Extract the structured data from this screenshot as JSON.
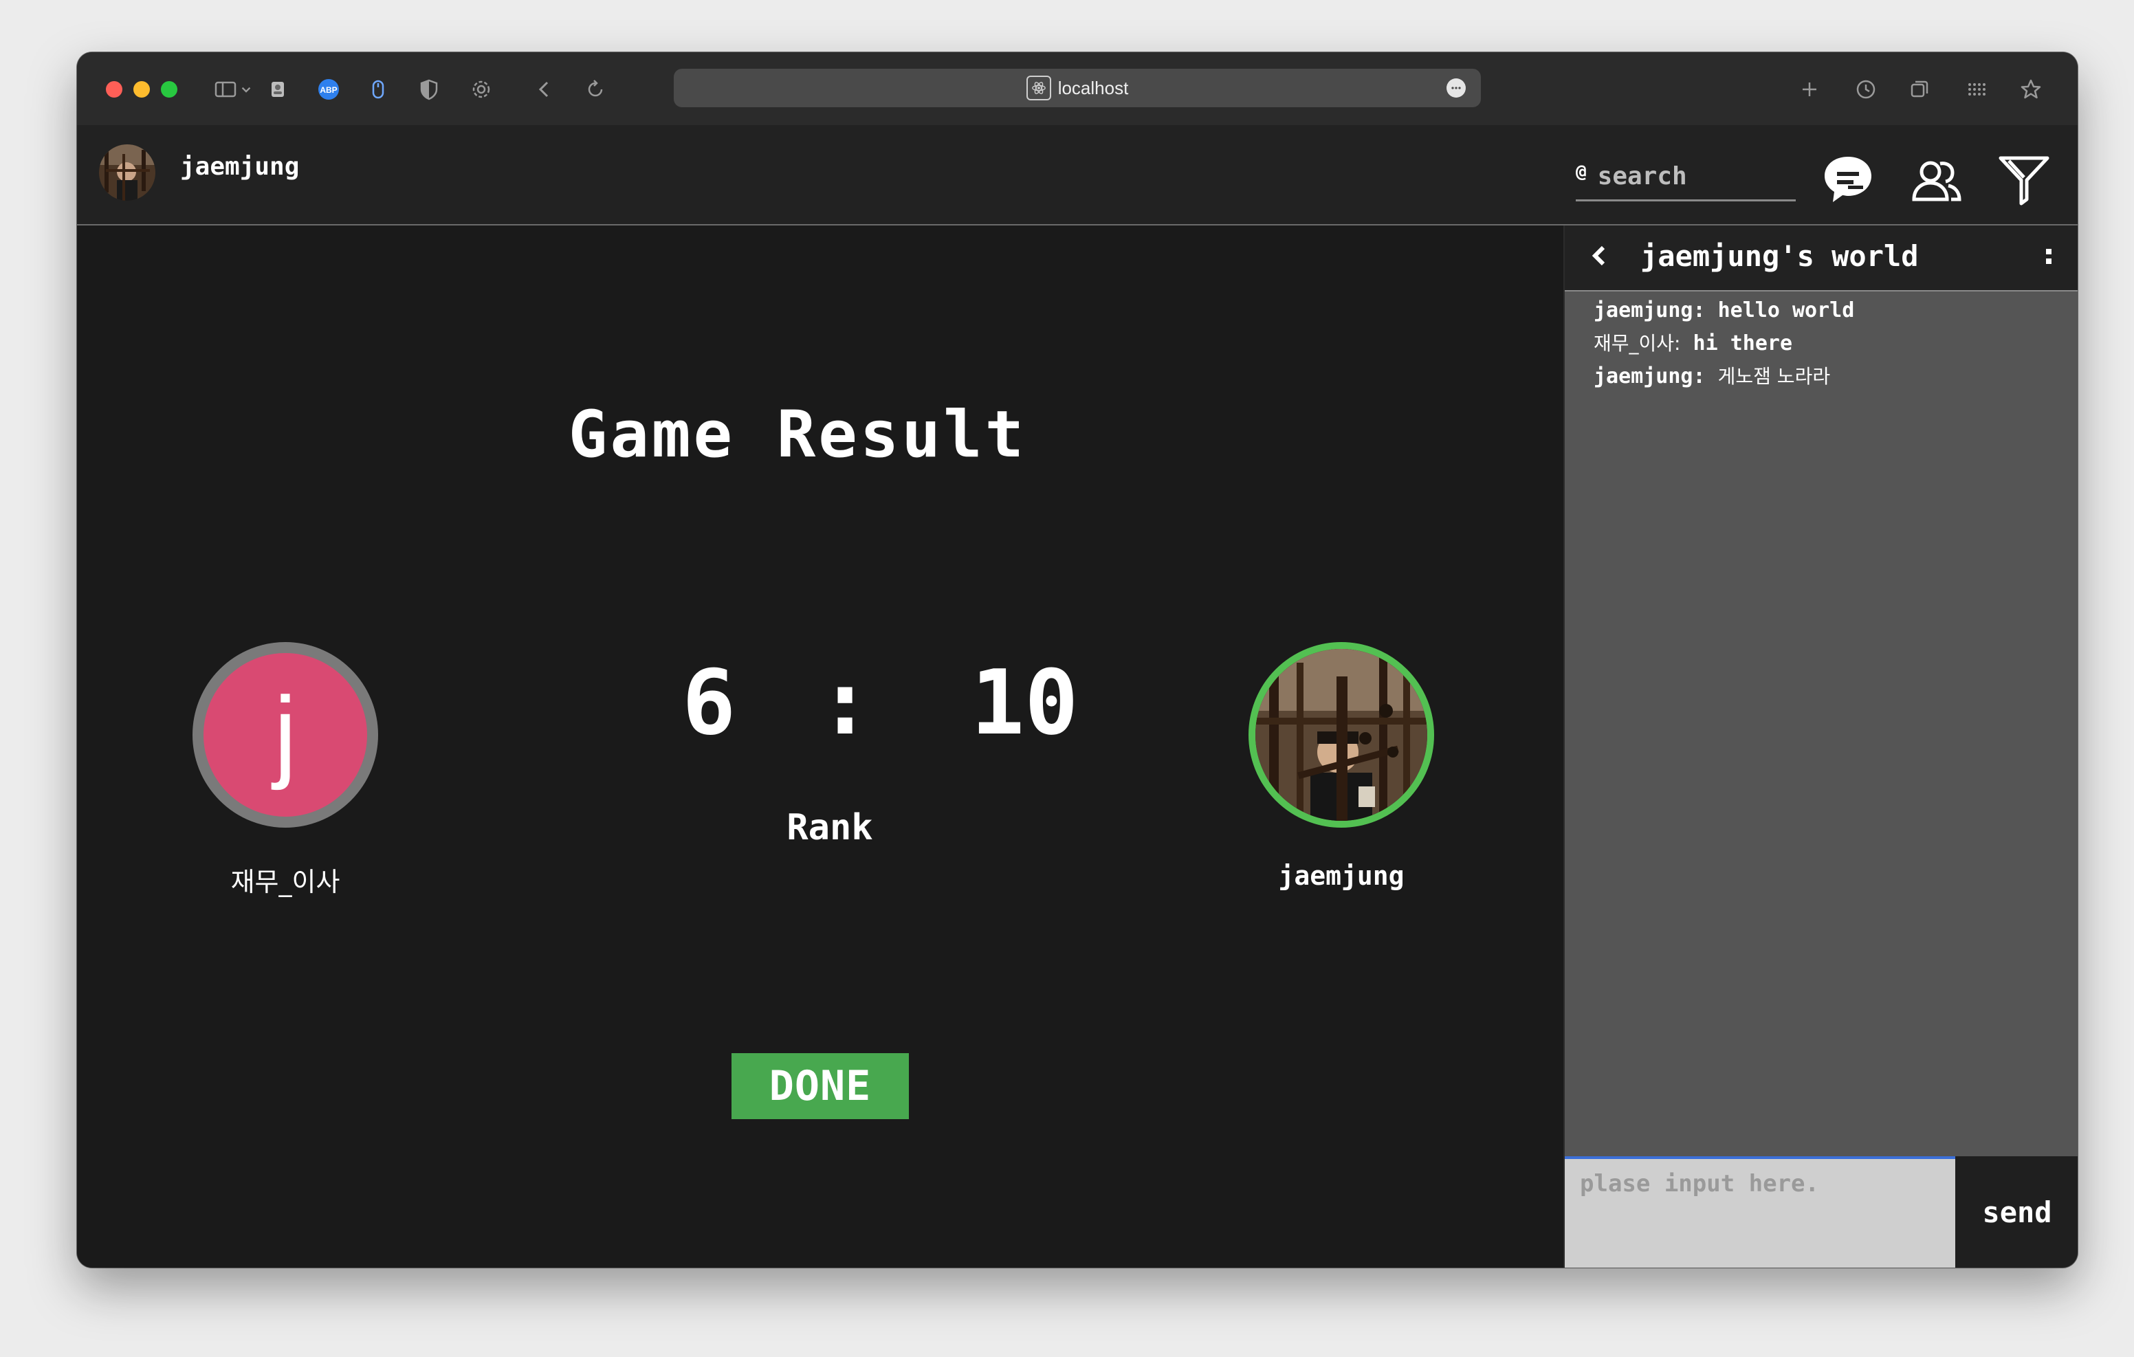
{
  "browser": {
    "url": "localhost"
  },
  "header": {
    "username": "jaemjung",
    "search_placeholder": "search",
    "search_prefix": "@"
  },
  "game": {
    "title": "Game Result",
    "score_left": "6",
    "score_separator": ":",
    "score_right": "10",
    "mode": "Rank",
    "done_label": "DONE",
    "player_left": {
      "name": "재무_이사",
      "avatar_letter": "j",
      "avatar_color": "#d94a72",
      "ring_color": "#7a7a7a"
    },
    "player_right": {
      "name": "jaemjung",
      "ring_color": "#53c052"
    }
  },
  "chat": {
    "title": "jaemjung's world",
    "messages": [
      {
        "sender": "jaemjung:",
        "text": "hello world"
      },
      {
        "sender": "재무_이사:",
        "text": "hi there"
      },
      {
        "sender": "jaemjung:",
        "text": "게노잼 노라라"
      }
    ],
    "input_placeholder": "plase input here.",
    "send_label": "send"
  }
}
